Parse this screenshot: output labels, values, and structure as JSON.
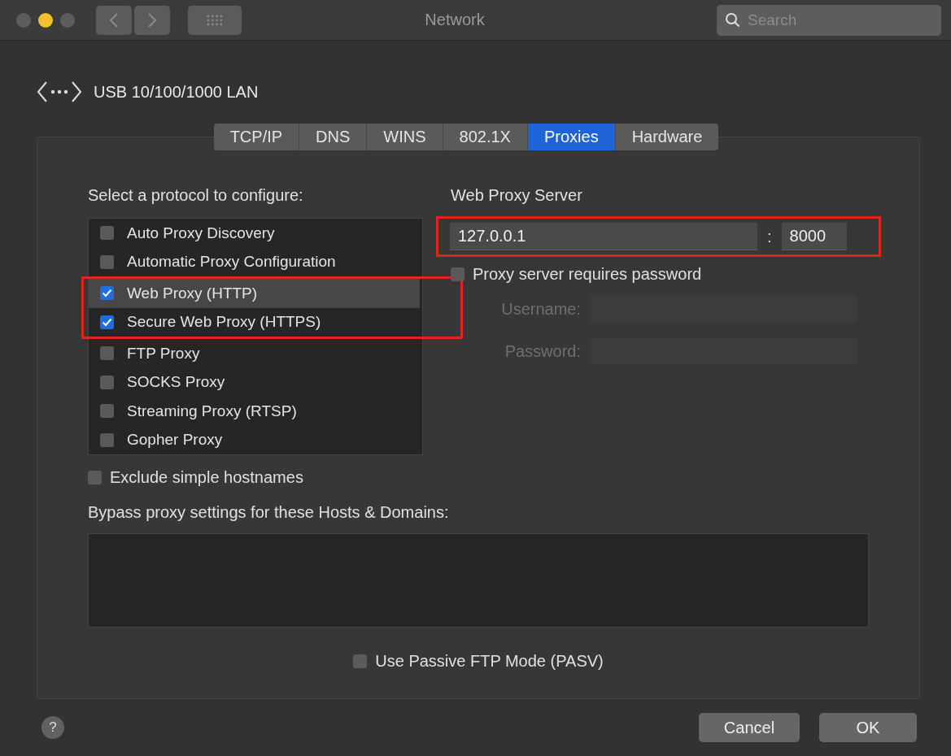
{
  "window": {
    "title": "Network",
    "search": {
      "placeholder": "Search"
    }
  },
  "interface": {
    "name": "USB 10/100/1000 LAN"
  },
  "tabs": [
    {
      "label": "TCP/IP",
      "selected": false
    },
    {
      "label": "DNS",
      "selected": false
    },
    {
      "label": "WINS",
      "selected": false
    },
    {
      "label": "802.1X",
      "selected": false
    },
    {
      "label": "Proxies",
      "selected": true
    },
    {
      "label": "Hardware",
      "selected": false
    }
  ],
  "protocols": {
    "label": "Select a protocol to configure:",
    "items": [
      {
        "label": "Auto Proxy Discovery",
        "checked": false,
        "selected": false,
        "highlighted": false
      },
      {
        "label": "Automatic Proxy Configuration",
        "checked": false,
        "selected": false,
        "highlighted": false
      },
      {
        "label": "Web Proxy (HTTP)",
        "checked": true,
        "selected": true,
        "highlighted": true
      },
      {
        "label": "Secure Web Proxy (HTTPS)",
        "checked": true,
        "selected": false,
        "highlighted": true
      },
      {
        "label": "FTP Proxy",
        "checked": false,
        "selected": false,
        "highlighted": false
      },
      {
        "label": "SOCKS Proxy",
        "checked": false,
        "selected": false,
        "highlighted": false
      },
      {
        "label": "Streaming Proxy (RTSP)",
        "checked": false,
        "selected": false,
        "highlighted": false
      },
      {
        "label": "Gopher Proxy",
        "checked": false,
        "selected": false,
        "highlighted": false
      }
    ]
  },
  "server": {
    "label": "Web Proxy Server",
    "host": "127.0.0.1",
    "separator": ":",
    "port": "8000",
    "highlighted": true,
    "requires_password": {
      "label": "Proxy server requires password",
      "checked": false
    },
    "fields": [
      {
        "label": "Username:",
        "disabled": true
      },
      {
        "label": "Password:",
        "disabled": true
      }
    ]
  },
  "exclude_simple": {
    "label": "Exclude simple hostnames",
    "checked": false
  },
  "bypass": {
    "label": "Bypass proxy settings for these Hosts & Domains:"
  },
  "passive_ftp": {
    "label": "Use Passive FTP Mode (PASV)",
    "checked": false
  },
  "help": "?",
  "buttons": [
    {
      "label": "Cancel",
      "kind": "cancel"
    },
    {
      "label": "OK",
      "kind": "default"
    }
  ]
}
